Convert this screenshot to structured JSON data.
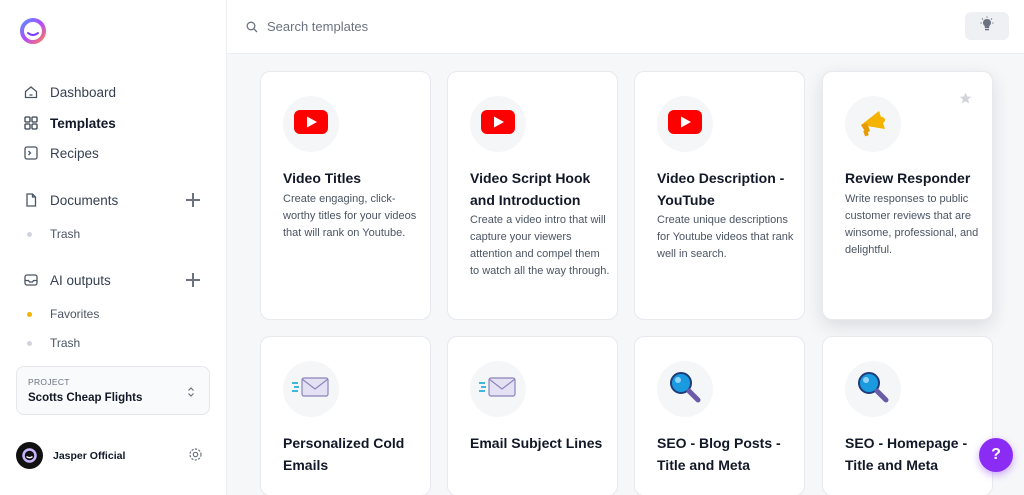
{
  "sidebar": {
    "nav": [
      {
        "label": "Dashboard",
        "icon": "home-icon"
      },
      {
        "label": "Templates",
        "icon": "grid-icon"
      },
      {
        "label": "Recipes",
        "icon": "terminal-icon"
      }
    ],
    "documents": {
      "label": "Documents",
      "icon": "file-icon",
      "children": [
        "Trash"
      ]
    },
    "ai_outputs": {
      "label": "AI outputs",
      "icon": "inbox-icon",
      "children": [
        "Favorites",
        "Trash"
      ]
    },
    "project": {
      "label": "PROJECT",
      "name": "Scotts Cheap Flights"
    },
    "user": {
      "name": "Jasper Official"
    }
  },
  "search": {
    "placeholder": "Search templates",
    "value": ""
  },
  "colors": {
    "accent": "#8b2cf5",
    "youtube": "#ff0000",
    "favorite_dot": "#f5b301"
  },
  "cards": [
    {
      "title": "Video Titles",
      "description": "Create engaging, click-worthy titles for your videos that will rank on Youtube.",
      "icon": "youtube-icon"
    },
    {
      "title": "Video Script Hook and Introduction",
      "description": "Create a video intro that will capture your viewers attention and compel them to watch all the way through.",
      "icon": "youtube-icon"
    },
    {
      "title": "Video Description - YouTube",
      "description": "Create unique descriptions for Youtube videos that rank well in search.",
      "icon": "youtube-icon"
    },
    {
      "title": "Review Responder",
      "description": "Write responses to public customer reviews that are winsome, professional, and delightful.",
      "icon": "megaphone-icon"
    },
    {
      "title": "Personalized Cold Emails",
      "description": "",
      "icon": "envelope-icon"
    },
    {
      "title": "Email Subject Lines",
      "description": "",
      "icon": "envelope-icon"
    },
    {
      "title": "SEO - Blog Posts - Title and Meta",
      "description": "",
      "icon": "magnifier-icon"
    },
    {
      "title": "SEO - Homepage - Title and Meta",
      "description": "",
      "icon": "magnifier-icon"
    }
  ],
  "help": {
    "label": "?"
  }
}
